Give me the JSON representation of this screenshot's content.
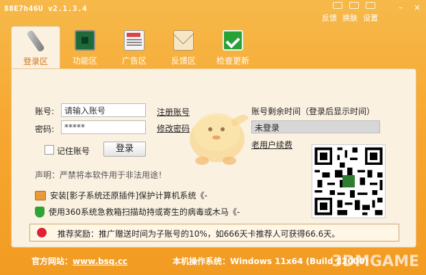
{
  "window": {
    "title": "88E7h46U v2.1.3.4",
    "top_links": [
      "反馈",
      "换肤",
      "设置"
    ],
    "buttons": {
      "minimize": "–",
      "close": "×"
    }
  },
  "nav": {
    "items": [
      {
        "label": "登录区",
        "icon": "chain-link-icon",
        "active": true
      },
      {
        "label": "功能区",
        "icon": "chip-icon",
        "active": false
      },
      {
        "label": "广告区",
        "icon": "newspaper-icon",
        "active": false
      },
      {
        "label": "反馈区",
        "icon": "envelope-icon",
        "active": false
      },
      {
        "label": "检查更新",
        "icon": "check-update-icon",
        "active": false
      }
    ]
  },
  "login": {
    "account_label": "账号:",
    "account_value": "请输入账号",
    "password_label": "密码:",
    "password_value": "*****",
    "register_link": "注册账号",
    "change_pwd_link": "修改密码",
    "remember_label": "记住账号",
    "login_button": "登录",
    "remaining_label": "账号剩余时间（登录后显示时间）",
    "status_value": "未登录",
    "renew_link": "老用户续费"
  },
  "declaration": "声明：严禁将本软件用于非法用途！",
  "notices": [
    {
      "icon": "shadow-system-icon",
      "text": "安装[影子系统还原插件]保护计算机系统《-"
    },
    {
      "icon": "shield-icon",
      "text": "使用360系统急救箱扫描劫持或寄生的病毒或木马《-"
    }
  ],
  "promo": {
    "text": "推荐奖励：推广赠送时间为子账号的10%，如666天卡推荐人可获得66.6天。"
  },
  "footer": {
    "site_label": "官方网站：",
    "site_url": "www.bsq.cc",
    "os_label": "本机操作系统：",
    "os_value": "Windows 11x64 (Build 22000)",
    "watermark": "3DMGAME"
  }
}
